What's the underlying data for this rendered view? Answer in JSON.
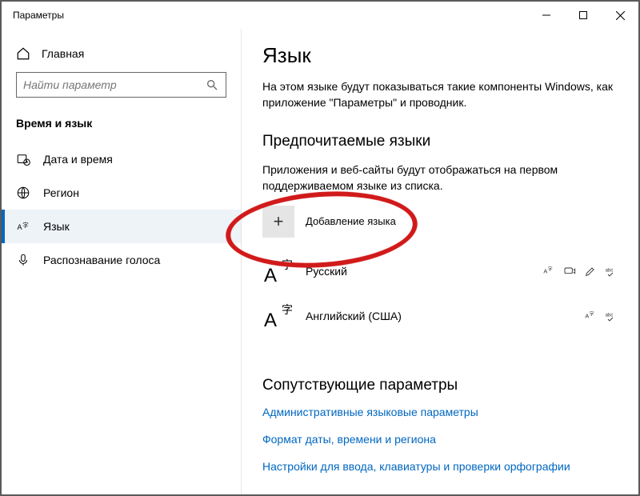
{
  "window": {
    "title": "Параметры"
  },
  "sidebar": {
    "home": "Главная",
    "search_placeholder": "Найти параметр",
    "section": "Время и язык",
    "items": [
      {
        "label": "Дата и время"
      },
      {
        "label": "Регион"
      },
      {
        "label": "Язык"
      },
      {
        "label": "Распознавание голоса"
      }
    ]
  },
  "main": {
    "title": "Язык",
    "desc": "На этом языке будут показываться такие компоненты Windows, как приложение \"Параметры\" и проводник.",
    "preferred_title": "Предпочитаемые языки",
    "preferred_desc": "Приложения и веб-сайты будут отображаться на первом поддерживаемом языке из списка.",
    "add_language": "Добавление языка",
    "languages": [
      {
        "name": "Русский"
      },
      {
        "name": "Английский (США)"
      }
    ],
    "related_title": "Сопутствующие параметры",
    "links": [
      "Административные языковые параметры",
      "Формат даты, времени и региона",
      "Настройки для ввода, клавиатуры и проверки орфографии"
    ]
  }
}
